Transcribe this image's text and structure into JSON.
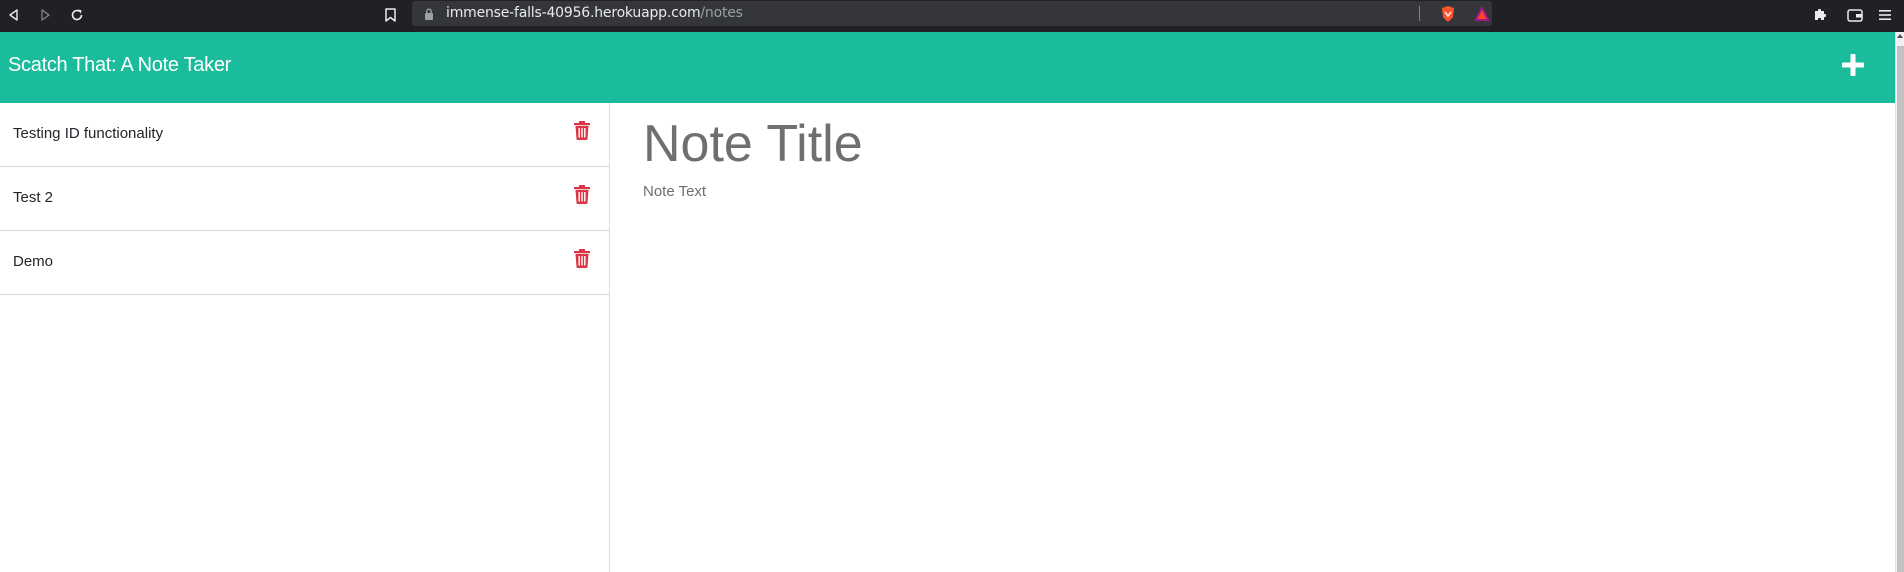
{
  "browser": {
    "url_host": "immense-falls-40956.herokuapp.com",
    "url_path": "/notes"
  },
  "icons": {
    "back": "back-icon",
    "forward": "forward-icon",
    "reload": "reload-icon",
    "bookmark": "bookmark-icon",
    "lock": "lock-icon",
    "brave": "brave-shield-icon",
    "rewards": "brave-rewards-icon",
    "extensions": "puzzle-icon",
    "wallet": "wallet-icon",
    "menu": "menu-icon",
    "new_note": "plus-icon",
    "delete": "trash-icon"
  },
  "colors": {
    "header": "#1abc9c",
    "delete": "#dc3545",
    "placeholder": "#6f6f6f"
  },
  "app": {
    "title": "Scatch That: A Note Taker"
  },
  "notes": [
    {
      "title": "Testing ID functionality"
    },
    {
      "title": "Test 2"
    },
    {
      "title": "Demo"
    }
  ],
  "editor": {
    "title_placeholder": "Note Title",
    "text_placeholder": "Note Text"
  }
}
